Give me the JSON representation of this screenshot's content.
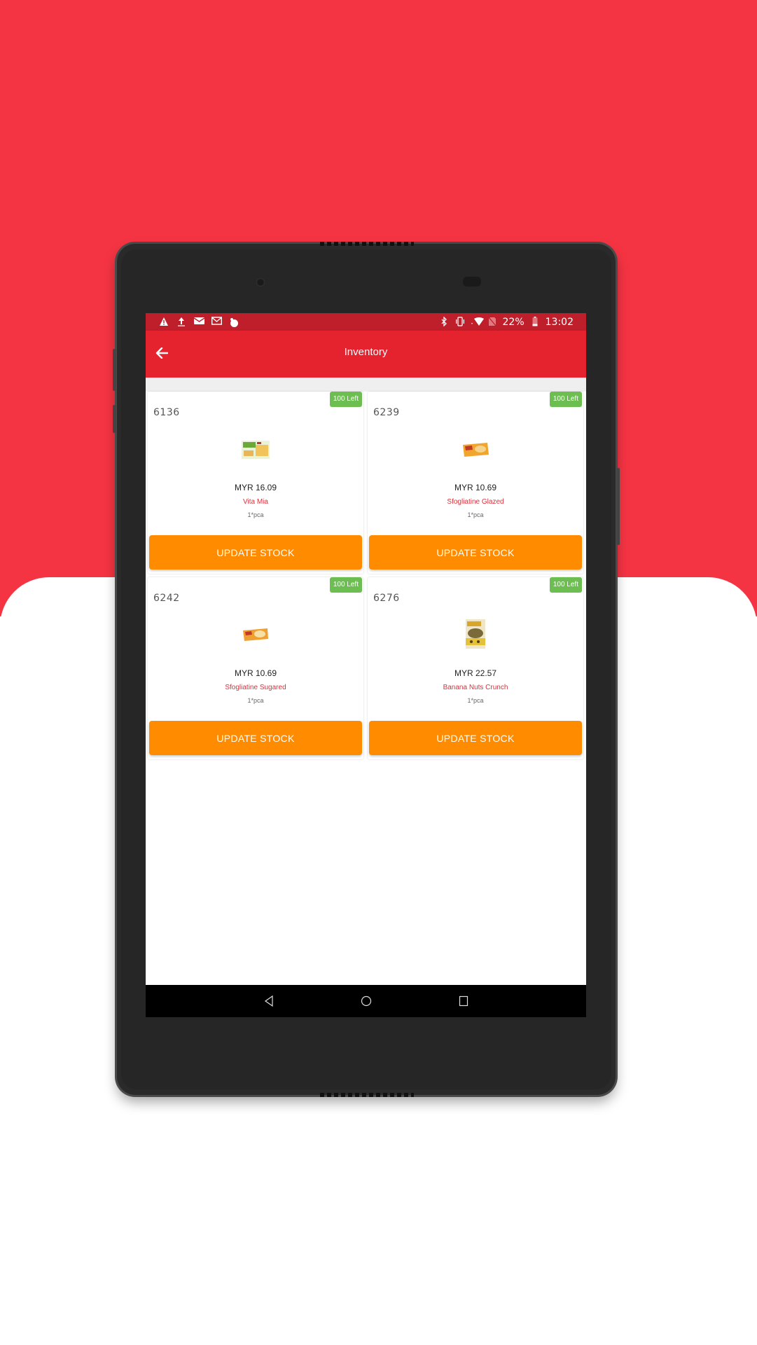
{
  "status_bar": {
    "left_icons": [
      "warning-icon",
      "upload-icon",
      "email-icon",
      "gmail-icon",
      "app-notification-icon"
    ],
    "right_icons": [
      "bluetooth-icon",
      "vibrate-icon",
      "wifi-icon",
      "no-sim-icon"
    ],
    "battery": "22%",
    "time": "13:02"
  },
  "app_bar": {
    "title": "Inventory",
    "back_icon": "arrow-left-icon"
  },
  "colors": {
    "background_red": "#f43443",
    "app_bar": "#e4232f",
    "status_bar": "#be1f2b",
    "badge": "#6bbe4f",
    "button": "#fe8b00",
    "product_name": "#d9303b"
  },
  "products": [
    {
      "id": "6136",
      "stock": "100 Left",
      "price": "MYR 16.09",
      "name": "Vita Mia",
      "unit": "1*pca",
      "button": "UPDATE STOCK"
    },
    {
      "id": "6239",
      "stock": "100 Left",
      "price": "MYR 10.69",
      "name": "Sfogliatine Glazed",
      "unit": "1*pca",
      "button": "UPDATE STOCK"
    },
    {
      "id": "6242",
      "stock": "100 Left",
      "price": "MYR 10.69",
      "name": "Sfogliatine Sugared",
      "unit": "1*pca",
      "button": "UPDATE STOCK"
    },
    {
      "id": "6276",
      "stock": "100 Left",
      "price": "MYR 22.57",
      "name": "Banana Nuts Crunch",
      "unit": "1*pca",
      "button": "UPDATE STOCK"
    }
  ],
  "nav_bar": {
    "buttons": [
      "back-triangle-icon",
      "home-circle-icon",
      "recents-square-icon"
    ]
  }
}
